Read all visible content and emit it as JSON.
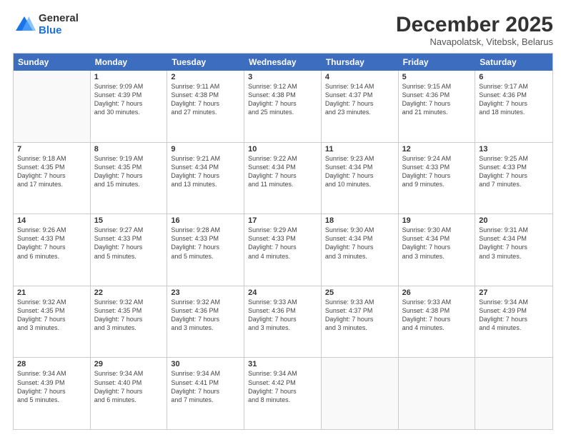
{
  "logo": {
    "general": "General",
    "blue": "Blue"
  },
  "header": {
    "month": "December 2025",
    "location": "Navapolatsk, Vitebsk, Belarus"
  },
  "dayHeaders": [
    "Sunday",
    "Monday",
    "Tuesday",
    "Wednesday",
    "Thursday",
    "Friday",
    "Saturday"
  ],
  "weeks": [
    [
      {
        "day": "",
        "info": ""
      },
      {
        "day": "1",
        "info": "Sunrise: 9:09 AM\nSunset: 4:39 PM\nDaylight: 7 hours\nand 30 minutes."
      },
      {
        "day": "2",
        "info": "Sunrise: 9:11 AM\nSunset: 4:38 PM\nDaylight: 7 hours\nand 27 minutes."
      },
      {
        "day": "3",
        "info": "Sunrise: 9:12 AM\nSunset: 4:38 PM\nDaylight: 7 hours\nand 25 minutes."
      },
      {
        "day": "4",
        "info": "Sunrise: 9:14 AM\nSunset: 4:37 PM\nDaylight: 7 hours\nand 23 minutes."
      },
      {
        "day": "5",
        "info": "Sunrise: 9:15 AM\nSunset: 4:36 PM\nDaylight: 7 hours\nand 21 minutes."
      },
      {
        "day": "6",
        "info": "Sunrise: 9:17 AM\nSunset: 4:36 PM\nDaylight: 7 hours\nand 18 minutes."
      }
    ],
    [
      {
        "day": "7",
        "info": "Sunrise: 9:18 AM\nSunset: 4:35 PM\nDaylight: 7 hours\nand 17 minutes."
      },
      {
        "day": "8",
        "info": "Sunrise: 9:19 AM\nSunset: 4:35 PM\nDaylight: 7 hours\nand 15 minutes."
      },
      {
        "day": "9",
        "info": "Sunrise: 9:21 AM\nSunset: 4:34 PM\nDaylight: 7 hours\nand 13 minutes."
      },
      {
        "day": "10",
        "info": "Sunrise: 9:22 AM\nSunset: 4:34 PM\nDaylight: 7 hours\nand 11 minutes."
      },
      {
        "day": "11",
        "info": "Sunrise: 9:23 AM\nSunset: 4:34 PM\nDaylight: 7 hours\nand 10 minutes."
      },
      {
        "day": "12",
        "info": "Sunrise: 9:24 AM\nSunset: 4:33 PM\nDaylight: 7 hours\nand 9 minutes."
      },
      {
        "day": "13",
        "info": "Sunrise: 9:25 AM\nSunset: 4:33 PM\nDaylight: 7 hours\nand 7 minutes."
      }
    ],
    [
      {
        "day": "14",
        "info": "Sunrise: 9:26 AM\nSunset: 4:33 PM\nDaylight: 7 hours\nand 6 minutes."
      },
      {
        "day": "15",
        "info": "Sunrise: 9:27 AM\nSunset: 4:33 PM\nDaylight: 7 hours\nand 5 minutes."
      },
      {
        "day": "16",
        "info": "Sunrise: 9:28 AM\nSunset: 4:33 PM\nDaylight: 7 hours\nand 5 minutes."
      },
      {
        "day": "17",
        "info": "Sunrise: 9:29 AM\nSunset: 4:33 PM\nDaylight: 7 hours\nand 4 minutes."
      },
      {
        "day": "18",
        "info": "Sunrise: 9:30 AM\nSunset: 4:34 PM\nDaylight: 7 hours\nand 3 minutes."
      },
      {
        "day": "19",
        "info": "Sunrise: 9:30 AM\nSunset: 4:34 PM\nDaylight: 7 hours\nand 3 minutes."
      },
      {
        "day": "20",
        "info": "Sunrise: 9:31 AM\nSunset: 4:34 PM\nDaylight: 7 hours\nand 3 minutes."
      }
    ],
    [
      {
        "day": "21",
        "info": "Sunrise: 9:32 AM\nSunset: 4:35 PM\nDaylight: 7 hours\nand 3 minutes."
      },
      {
        "day": "22",
        "info": "Sunrise: 9:32 AM\nSunset: 4:35 PM\nDaylight: 7 hours\nand 3 minutes."
      },
      {
        "day": "23",
        "info": "Sunrise: 9:32 AM\nSunset: 4:36 PM\nDaylight: 7 hours\nand 3 minutes."
      },
      {
        "day": "24",
        "info": "Sunrise: 9:33 AM\nSunset: 4:36 PM\nDaylight: 7 hours\nand 3 minutes."
      },
      {
        "day": "25",
        "info": "Sunrise: 9:33 AM\nSunset: 4:37 PM\nDaylight: 7 hours\nand 3 minutes."
      },
      {
        "day": "26",
        "info": "Sunrise: 9:33 AM\nSunset: 4:38 PM\nDaylight: 7 hours\nand 4 minutes."
      },
      {
        "day": "27",
        "info": "Sunrise: 9:34 AM\nSunset: 4:39 PM\nDaylight: 7 hours\nand 4 minutes."
      }
    ],
    [
      {
        "day": "28",
        "info": "Sunrise: 9:34 AM\nSunset: 4:39 PM\nDaylight: 7 hours\nand 5 minutes."
      },
      {
        "day": "29",
        "info": "Sunrise: 9:34 AM\nSunset: 4:40 PM\nDaylight: 7 hours\nand 6 minutes."
      },
      {
        "day": "30",
        "info": "Sunrise: 9:34 AM\nSunset: 4:41 PM\nDaylight: 7 hours\nand 7 minutes."
      },
      {
        "day": "31",
        "info": "Sunrise: 9:34 AM\nSunset: 4:42 PM\nDaylight: 7 hours\nand 8 minutes."
      },
      {
        "day": "",
        "info": ""
      },
      {
        "day": "",
        "info": ""
      },
      {
        "day": "",
        "info": ""
      }
    ]
  ]
}
